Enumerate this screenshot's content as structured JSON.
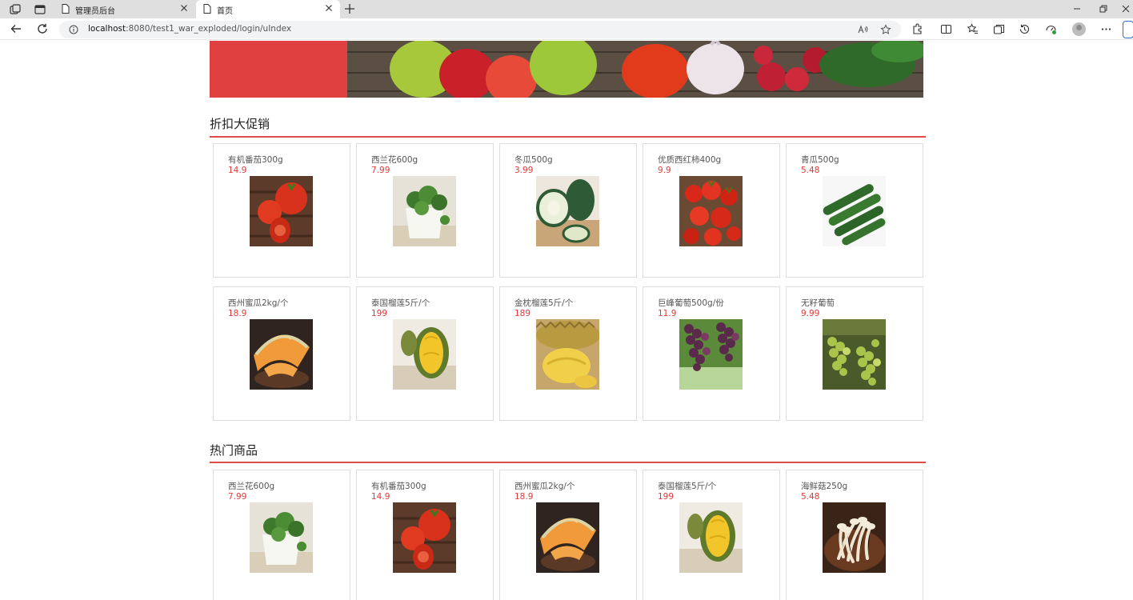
{
  "browser": {
    "tabs": [
      {
        "label": "管理员后台",
        "active": false
      },
      {
        "label": "首页",
        "active": true
      }
    ],
    "url_host": "localhost",
    "url_rest": ":8080/test1_war_exploded/login/uIndex"
  },
  "colors": {
    "accent": "#e04b4b",
    "price": "#e23a3a",
    "banner_red": "#e04040"
  },
  "sections": [
    {
      "title": "折扣大促销",
      "products": [
        {
          "name": "有机番茄300g",
          "price": "14.9",
          "image": "tomato"
        },
        {
          "name": "西兰花600g",
          "price": "7.99",
          "image": "broccoli"
        },
        {
          "name": "冬瓜500g",
          "price": "3.99",
          "image": "wax-gourd"
        },
        {
          "name": "优质西红柿400g",
          "price": "9.9",
          "image": "cherry-tomato"
        },
        {
          "name": "青瓜500g",
          "price": "5.48",
          "image": "cucumber"
        },
        {
          "name": "西州蜜瓜2kg/个",
          "price": "18.9",
          "image": "melon"
        },
        {
          "name": "泰国榴莲5斤/个",
          "price": "199",
          "image": "durian"
        },
        {
          "name": "金枕榴莲5斤/个",
          "price": "189",
          "image": "durian-golden"
        },
        {
          "name": "巨峰葡萄500g/份",
          "price": "11.9",
          "image": "grape-purple"
        },
        {
          "name": "无籽葡萄",
          "price": "9.99",
          "image": "grape-green"
        }
      ]
    },
    {
      "title": "热门商品",
      "products": [
        {
          "name": "西兰花600g",
          "price": "7.99",
          "image": "broccoli"
        },
        {
          "name": "有机番茄300g",
          "price": "14.9",
          "image": "tomato"
        },
        {
          "name": "西州蜜瓜2kg/个",
          "price": "18.9",
          "image": "melon"
        },
        {
          "name": "泰国榴莲5斤/个",
          "price": "199",
          "image": "durian"
        },
        {
          "name": "海鲜菇250g",
          "price": "5.48",
          "image": "mushroom"
        }
      ]
    }
  ]
}
